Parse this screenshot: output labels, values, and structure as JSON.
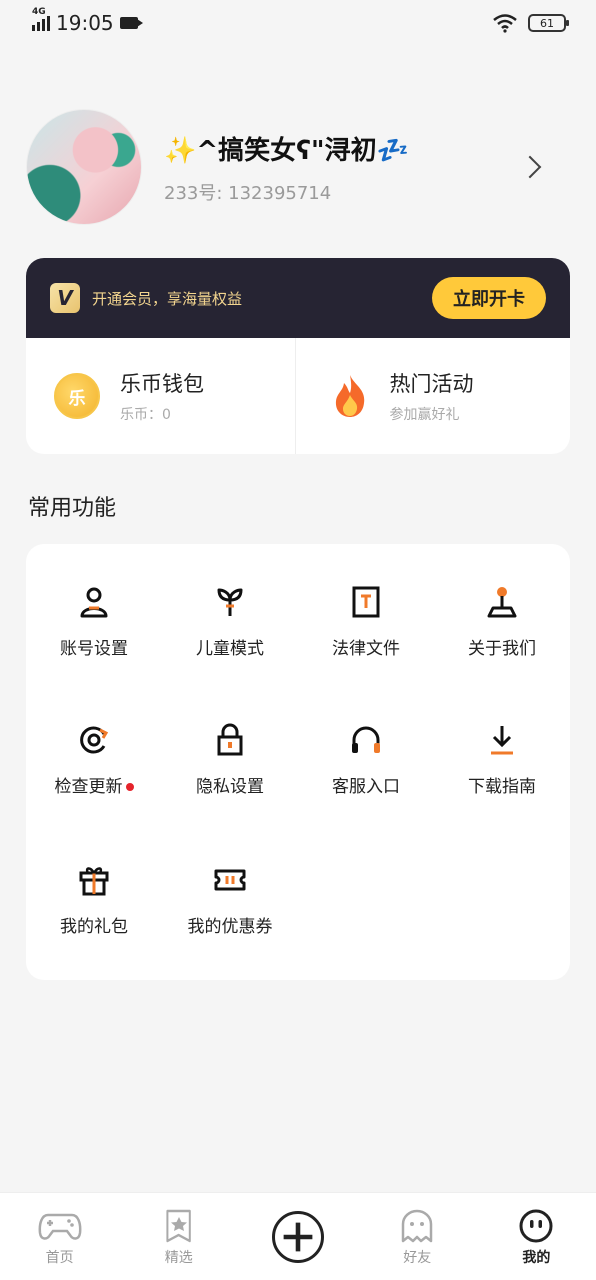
{
  "status_bar": {
    "network": "4G",
    "time": "19:05",
    "battery": "61"
  },
  "profile": {
    "nickname": "✨^搞笑女ʕ\"浔初💤",
    "uid_label": "233号: 132395714"
  },
  "vip": {
    "badge": "V",
    "promo_text": "开通会员，享海量权益",
    "button_label": "立即开卡"
  },
  "wallet": {
    "title": "乐币钱包",
    "sub": "乐币：0",
    "coin_glyph": "乐"
  },
  "activity": {
    "title": "热门活动",
    "sub": "参加赢好礼"
  },
  "section_title": "常用功能",
  "functions": [
    {
      "label": "账号设置",
      "icon": "user-icon"
    },
    {
      "label": "儿童模式",
      "icon": "sprout-icon"
    },
    {
      "label": "法律文件",
      "icon": "document-icon"
    },
    {
      "label": "关于我们",
      "icon": "joystick-icon"
    },
    {
      "label": "检查更新",
      "icon": "update-icon",
      "badge": "red-dot"
    },
    {
      "label": "隐私设置",
      "icon": "lock-icon"
    },
    {
      "label": "客服入口",
      "icon": "headset-icon"
    },
    {
      "label": "下载指南",
      "icon": "download-icon"
    },
    {
      "label": "我的礼包",
      "icon": "gift-icon"
    },
    {
      "label": "我的优惠券",
      "icon": "coupon-icon"
    }
  ],
  "bottom_nav": [
    {
      "label": "首页",
      "icon": "gamepad-icon"
    },
    {
      "label": "精选",
      "icon": "star-bookmark-icon"
    },
    {
      "label": "",
      "icon": "plus-icon"
    },
    {
      "label": "好友",
      "icon": "ghost-icon"
    },
    {
      "label": "我的",
      "icon": "smile-face-icon",
      "active": true
    }
  ],
  "colors": {
    "accent": "#ffc93a",
    "vip_bg": "#262433",
    "icon_accent": "#f07a2a",
    "active_underline": "#f06a2a"
  }
}
